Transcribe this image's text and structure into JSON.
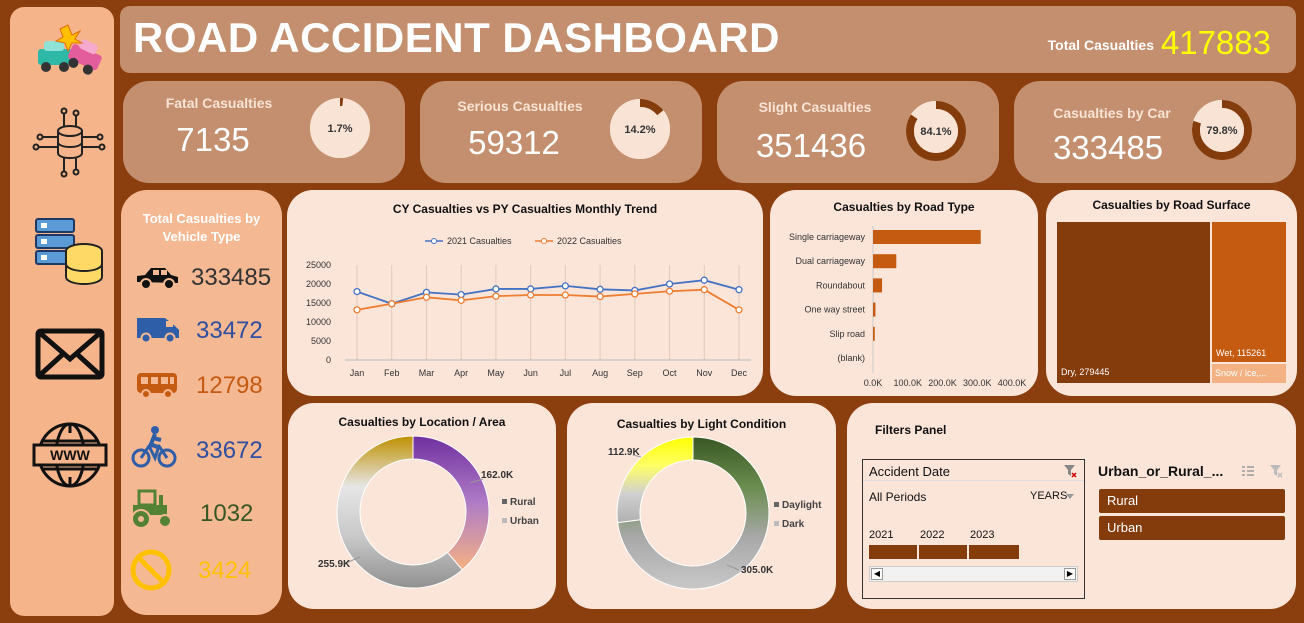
{
  "header": {
    "title": "ROAD ACCIDENT DASHBOARD",
    "total_label": "Total Casualties",
    "total_value": "417883"
  },
  "nav": [
    {
      "icon": "car-crash-icon"
    },
    {
      "icon": "database-circuit-icon"
    },
    {
      "icon": "server-database-icon"
    },
    {
      "icon": "mail-icon"
    },
    {
      "icon": "www-globe-icon"
    }
  ],
  "kpis": [
    {
      "label": "Fatal Casualties",
      "value": "7135",
      "pct_label": "1.7%",
      "pct": 0.017
    },
    {
      "label": "Serious Casualties",
      "value": "59312",
      "pct_label": "14.2%",
      "pct": 0.142
    },
    {
      "label": "Slight Casualties",
      "value": "351436",
      "pct_label": "84.1%",
      "pct": 0.841
    },
    {
      "label": "Casualties by Car",
      "value": "333485",
      "pct_label": "79.8%",
      "pct": 0.798
    }
  ],
  "vehicle": {
    "title": "Total Casualties by Vehicle Type",
    "items": [
      {
        "icon": "car-icon",
        "value": "333485",
        "color": "#333333"
      },
      {
        "icon": "van-icon",
        "value": "33472",
        "color": "#2F4E9E"
      },
      {
        "icon": "bus-icon",
        "value": "12798",
        "color": "#C55A11"
      },
      {
        "icon": "bicycle-icon",
        "value": "33672",
        "color": "#2F4E9E"
      },
      {
        "icon": "tractor-icon",
        "value": "1032",
        "color": "#375623"
      },
      {
        "icon": "prohibited-icon",
        "value": "3424",
        "color": "#FFC000"
      }
    ]
  },
  "trend": {
    "title": "CY Casualties vs PY Casualties Monthly Trend",
    "chart_data": {
      "type": "line",
      "categories": [
        "Jan",
        "Feb",
        "Mar",
        "Apr",
        "May",
        "Jun",
        "Jul",
        "Aug",
        "Sep",
        "Oct",
        "Nov",
        "Dec"
      ],
      "series": [
        {
          "name": "2021 Casualties",
          "color": "#4472C4",
          "values": [
            18000,
            14800,
            17800,
            17200,
            18700,
            18700,
            19500,
            18600,
            18300,
            20000,
            21000,
            18500
          ]
        },
        {
          "name": "2022 Casualties",
          "color": "#ED7D31",
          "values": [
            13200,
            14800,
            16500,
            15700,
            16800,
            17100,
            17100,
            16700,
            17400,
            18100,
            18500,
            13200
          ]
        }
      ],
      "yticks": [
        "0",
        "5000",
        "10000",
        "15000",
        "20000",
        "25000"
      ],
      "ylim": [
        0,
        25000
      ]
    }
  },
  "roadtype": {
    "title": "Casualties by Road Type",
    "chart_data": {
      "type": "bar",
      "categories": [
        "Single carriageway",
        "Dual carriageway",
        "Roundabout",
        "One way street",
        "Slip road",
        "(blank)"
      ],
      "values": [
        310000,
        67000,
        26000,
        7000,
        5000,
        0
      ],
      "xticks": [
        "0.0K",
        "100.0K",
        "200.0K",
        "300.0K",
        "400.0K"
      ],
      "xlim": [
        0,
        400000
      ],
      "color": "#C55A11"
    }
  },
  "surface": {
    "title": "Casualties by Road Surface",
    "chart_data": {
      "type": "treemap",
      "items": [
        {
          "label": "Dry, 279445",
          "value": 279445,
          "color": "#843C0C"
        },
        {
          "label": "Wet, 115261",
          "value": 115261,
          "color": "#C55A11"
        },
        {
          "label": "Snow / ice,...",
          "value": 23177,
          "color": "#F4B183"
        }
      ]
    }
  },
  "location": {
    "title": "Casualties by Location / Area",
    "chart_data": {
      "type": "pie",
      "categories": [
        "Rural",
        "Urban"
      ],
      "values": [
        162000,
        255900
      ],
      "labels": [
        "162.0K",
        "255.9K"
      ]
    }
  },
  "light": {
    "title": "Casualties by Light Condition",
    "chart_data": {
      "type": "pie",
      "categories": [
        "Daylight",
        "Dark"
      ],
      "values": [
        305000,
        112900
      ],
      "labels": [
        "305.0K",
        "112.9K"
      ]
    }
  },
  "filters": {
    "title": "Filters Panel",
    "date": {
      "title": "Accident Date",
      "period": "All Periods",
      "unit": "YEARS",
      "years": [
        "2021",
        "2022",
        "2023"
      ]
    },
    "area": {
      "title": "Urban_or_Rural_...",
      "options": [
        "Rural",
        "Urban"
      ]
    }
  }
}
